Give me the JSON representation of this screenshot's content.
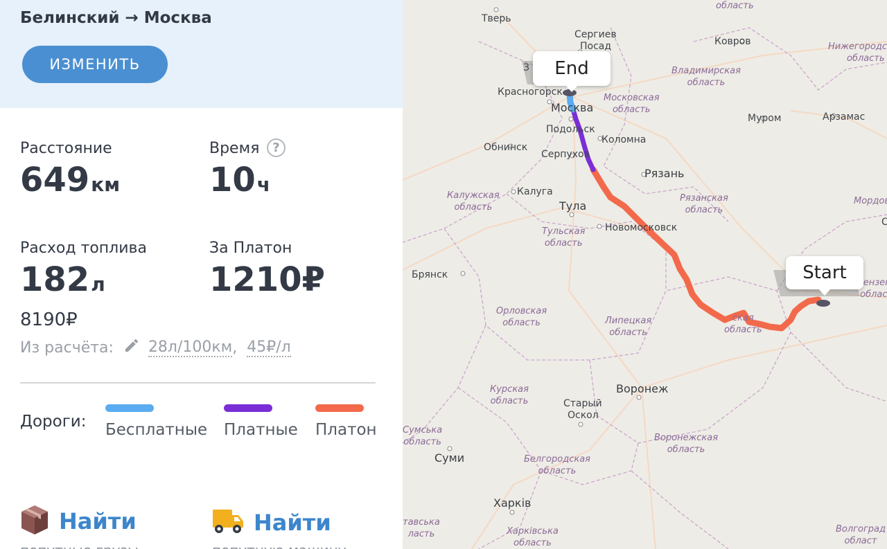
{
  "route": {
    "title": "Белинский → Москва",
    "change_label": "ИЗМЕНИТЬ"
  },
  "stats": {
    "distance": {
      "label": "Расстояние",
      "value": "649",
      "unit": "км"
    },
    "time": {
      "label": "Время",
      "value": "10",
      "unit": "ч",
      "help_symbol": "?"
    },
    "fuel": {
      "label": "Расход топлива",
      "value": "182",
      "unit": "л",
      "cost": "8190₽"
    },
    "platon": {
      "label": "За Платон",
      "value": "1210₽"
    }
  },
  "calc": {
    "prefix": "Из расчёта:",
    "consumption": "28л/100км",
    "separator": ",",
    "price": "45₽/л"
  },
  "roads": {
    "label": "Дороги:",
    "legend": [
      {
        "name": "Бесплатные",
        "color": "#5aabf0"
      },
      {
        "name": "Платные",
        "color": "#7a2ed6"
      },
      {
        "name": "Платон",
        "color": "#f26a4b"
      }
    ]
  },
  "find": [
    {
      "label": "Найти",
      "icon": "cargo-box-icon",
      "sub": "попутные грузы"
    },
    {
      "label": "Найти",
      "icon": "truck-icon",
      "sub": "попутную машину"
    }
  ],
  "map": {
    "markers": {
      "start": "Start",
      "end": "End"
    },
    "cities": {
      "tver": "Тверь",
      "sergiev": "Сергиев",
      "posad": "Посад",
      "kovrov": "Ковров",
      "krasnogorsk": "Красногорск",
      "moskva": "Москва",
      "podolsk": "Подольск",
      "obninsk": "Обнинск",
      "serpukhov": "Серпухов",
      "kolomna": "Коломна",
      "murom": "Муром",
      "arzamas": "Арзамас",
      "ryazan": "Рязань",
      "kaluga": "Калуга",
      "tula": "Тула",
      "novomoskovsk": "Новомосковск",
      "bryansk": "Брянск",
      "voronezh": "Воронеж",
      "stary": "Старый",
      "oskol": "Оскол",
      "sumy": "Суми",
      "kharkiv": "Харків",
      "z": "З",
      "c": "С"
    },
    "regions": {
      "tver_obl": "область",
      "vladimir": [
        "Владимирская",
        "область"
      ],
      "nizhny": [
        "Нижегородская",
        "область"
      ],
      "moscow_obl": [
        "Московская",
        "область"
      ],
      "kaluga_obl": [
        "Калужская",
        "область"
      ],
      "ryazan_obl": [
        "Рязанская",
        "область"
      ],
      "mordov": "Мордов",
      "tula_obl": [
        "Тульская",
        "область"
      ],
      "penza": [
        "Пензен",
        "облас"
      ],
      "orel": [
        "Орловская",
        "область"
      ],
      "lipetsk": [
        "Липецкая",
        "область"
      ],
      "tambov": [
        "ская",
        "область"
      ],
      "kursk": [
        "Курская",
        "область"
      ],
      "voronezh_obl": [
        "Воронежская",
        "область"
      ],
      "sumy_obl": [
        "Сумська",
        "область"
      ],
      "belgorod": [
        "Белгородская",
        "область"
      ],
      "kharkiv_obl": [
        "Харківська",
        "область"
      ],
      "volgograd": [
        "Волгоград",
        "област"
      ],
      "kharkivska_w": [
        "тавська",
        "ласть"
      ]
    }
  }
}
